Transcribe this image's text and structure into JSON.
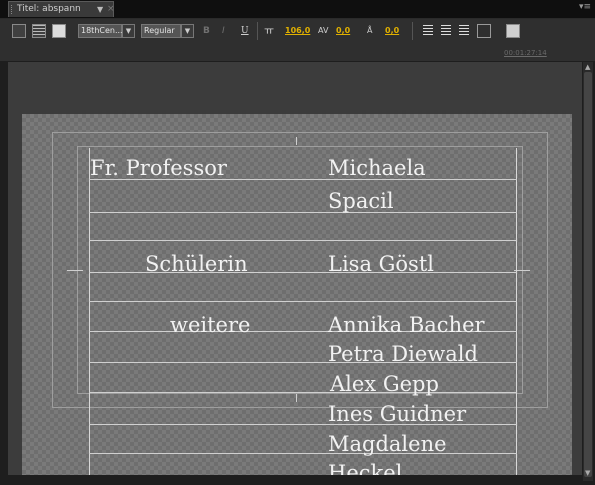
{
  "tab": {
    "title": "Titel: abspann"
  },
  "toolbar": {
    "font_family": "18thCen...",
    "font_style": "Regular",
    "bold": "B",
    "italic": "I",
    "underline": "U",
    "font_size": "106,0",
    "kerning": "0,0",
    "baseline_shift": "0,0",
    "timecode": "00:01:27:14"
  },
  "credits": [
    {
      "role": "Fr. Professor",
      "names": [
        "Michaela",
        "Spacil"
      ]
    },
    {
      "role": "Schülerin",
      "names": [
        "Lisa Göstl"
      ]
    },
    {
      "role": "weitere",
      "names": [
        "Annika Bacher",
        "Petra Diewald",
        "Alex Gepp",
        "Ines Guidner",
        "Magdalene",
        "Heckel"
      ]
    }
  ]
}
